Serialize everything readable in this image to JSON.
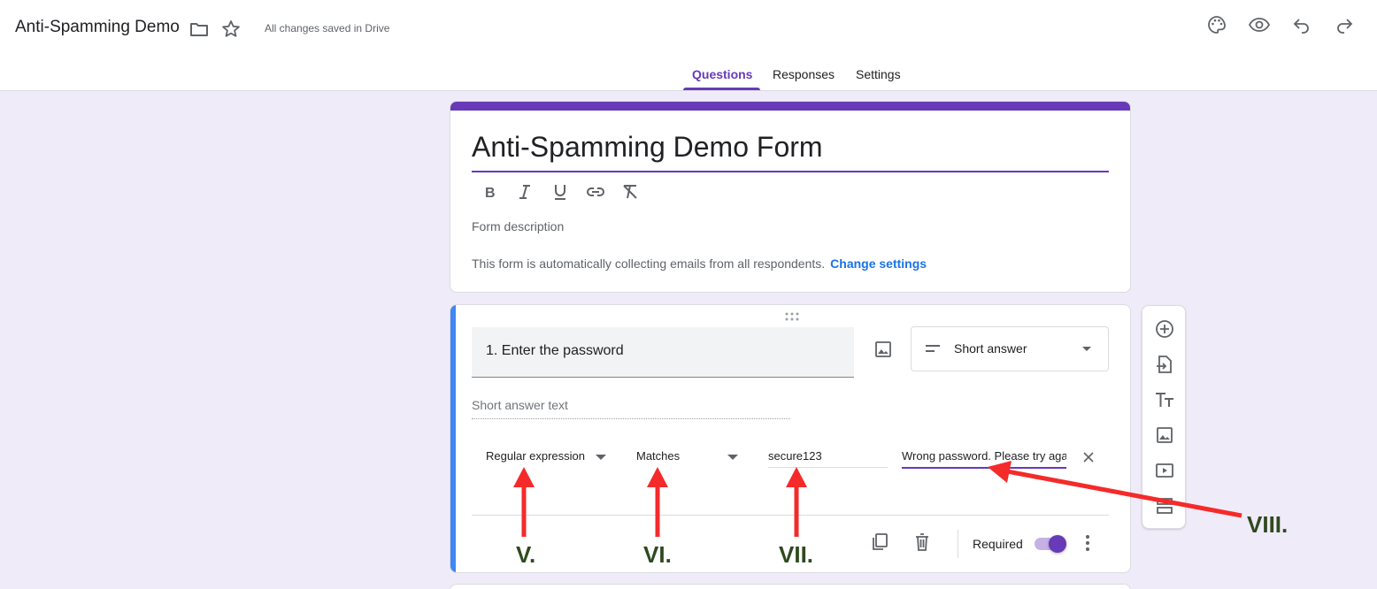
{
  "header": {
    "doc_title": "Anti-Spamming Demo",
    "save_status": "All changes saved in Drive"
  },
  "tabs": [
    {
      "label": "Questions",
      "active": true
    },
    {
      "label": "Responses",
      "active": false
    },
    {
      "label": "Settings",
      "active": false
    }
  ],
  "form": {
    "title": "Anti-Spamming Demo Form",
    "description_placeholder": "Form description",
    "collect_notice": "This form is automatically collecting emails from all respondents.",
    "change_settings": "Change settings"
  },
  "question": {
    "title": "1. Enter the password",
    "type": "Short answer",
    "answer_placeholder": "Short answer text",
    "validation": {
      "kind": "Regular expression",
      "condition": "Matches",
      "pattern": "secure123",
      "error_text": "Wrong password. Please try aga"
    },
    "required_label": "Required",
    "required": true
  },
  "annotations": [
    "V.",
    "VI.",
    "VII.",
    "VIII."
  ],
  "colors": {
    "accent": "#673ab7",
    "link": "#1a73e8",
    "annotation_arrow": "#f52a2a",
    "annotation_text": "#2e4a1f"
  }
}
